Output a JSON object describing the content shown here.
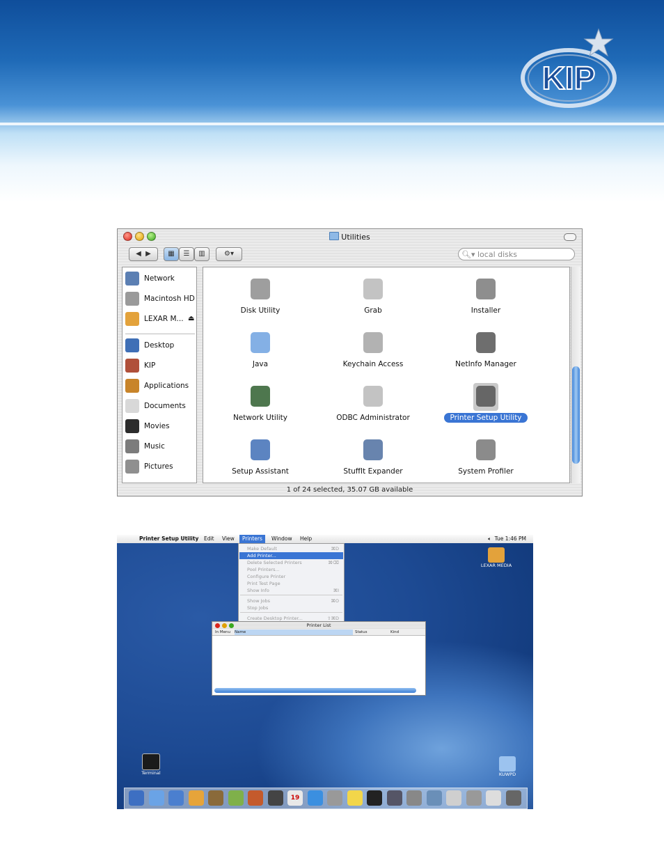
{
  "brand": {
    "logo_text": "KIP"
  },
  "finder": {
    "title": "Utilities",
    "search": {
      "placeholder": "local disks"
    },
    "sidebar_devices": [
      {
        "label": "Network",
        "icon": "network-globe-icon",
        "color": "#5b7fb3"
      },
      {
        "label": "Macintosh HD",
        "icon": "hard-drive-icon",
        "color": "#9a9a9a"
      },
      {
        "label": "LEXAR M...",
        "icon": "usb-drive-icon",
        "color": "#e3a23b"
      }
    ],
    "sidebar_places": [
      {
        "label": "Desktop",
        "icon": "desktop-icon",
        "color": "#3f6fb6"
      },
      {
        "label": "KIP",
        "icon": "home-icon",
        "color": "#b0503a"
      },
      {
        "label": "Applications",
        "icon": "applications-icon",
        "color": "#c8842a"
      },
      {
        "label": "Documents",
        "icon": "documents-icon",
        "color": "#d8d8d8"
      },
      {
        "label": "Movies",
        "icon": "movies-icon",
        "color": "#2c2c2c"
      },
      {
        "label": "Music",
        "icon": "music-icon",
        "color": "#7c7c7c"
      },
      {
        "label": "Pictures",
        "icon": "pictures-icon",
        "color": "#8f8f8f"
      }
    ],
    "apps": [
      {
        "label": "Disk Utility",
        "icon": "disk-utility-icon",
        "color": "#8d8d8d"
      },
      {
        "label": "Grab",
        "icon": "grab-icon",
        "color": "#b9b9b9"
      },
      {
        "label": "Installer",
        "icon": "installer-icon",
        "color": "#7a7a7a"
      },
      {
        "label": "Java",
        "icon": "java-folder-icon",
        "color": "#6fa2e0"
      },
      {
        "label": "Keychain Access",
        "icon": "keychain-icon",
        "color": "#a5a5a5"
      },
      {
        "label": "NetInfo Manager",
        "icon": "netinfo-icon",
        "color": "#555555"
      },
      {
        "label": "Network Utility",
        "icon": "network-utility-icon",
        "color": "#2f5f2f"
      },
      {
        "label": "ODBC Administrator",
        "icon": "odbc-icon",
        "color": "#b8b8b8"
      },
      {
        "label": "Printer Setup Utility",
        "icon": "printer-icon",
        "color": "#555555"
      },
      {
        "label": "Setup Assistant",
        "icon": "setup-assistant-icon",
        "color": "#3f6fb6"
      },
      {
        "label": "StuffIt Expander",
        "icon": "stuffit-icon",
        "color": "#4d6fa0"
      },
      {
        "label": "System Profiler",
        "icon": "system-profiler-icon",
        "color": "#777777"
      }
    ],
    "selected_app_index": 8,
    "status": "1 of 24 selected, 35.07 GB available"
  },
  "desktop": {
    "menubar": {
      "app_name": "Printer Setup Utility",
      "menus": [
        "Edit",
        "View",
        "Printers",
        "Window",
        "Help"
      ],
      "clock": "Tue 1:46 PM"
    },
    "printers_menu": [
      {
        "label": "Make Default",
        "shortcut": "⌘D"
      },
      {
        "label": "Add Printer...",
        "shortcut": ""
      },
      {
        "label": "Delete Selected Printers",
        "shortcut": "⌘⌫"
      },
      {
        "label": "Pool Printers...",
        "shortcut": ""
      },
      {
        "label": "Configure Printer",
        "shortcut": ""
      },
      {
        "label": "Print Test Page",
        "shortcut": ""
      },
      {
        "label": "Show Info",
        "shortcut": "⌘I"
      },
      {
        "label": "Show Jobs",
        "shortcut": "⌘O"
      },
      {
        "label": "Stop Jobs",
        "shortcut": ""
      },
      {
        "label": "Create Desktop Printer...",
        "shortcut": "⇧⌘D"
      }
    ],
    "printer_list": {
      "title": "Printer List",
      "columns": [
        "In Menu",
        "Name",
        "Status",
        "Kind"
      ]
    },
    "icons": {
      "lexar": "LEXAR MEDIA",
      "terminal": "Terminal",
      "kuwpd": "KUWPD"
    },
    "dock_calendar_day": "19"
  }
}
